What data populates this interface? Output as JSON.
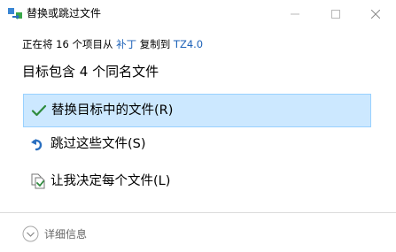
{
  "window": {
    "title": "替换或跳过文件",
    "minimize_icon": "minimize-icon",
    "maximize_icon": "maximize-icon",
    "close_icon": "close-icon"
  },
  "info": {
    "prefix": "正在将 16 个项目从",
    "source": "补丁",
    "middle": "复制到",
    "destination": "TZ4.0"
  },
  "heading": "目标包含 4 个同名文件",
  "options": [
    {
      "label": "替换目标中的文件(R)",
      "icon": "checkmark-icon",
      "selected": true
    },
    {
      "label": "跳过这些文件(S)",
      "icon": "skip-arrow-icon",
      "selected": false
    },
    {
      "label": "让我决定每个文件(L)",
      "icon": "compare-files-icon",
      "selected": false
    }
  ],
  "details": {
    "label": "详细信息",
    "icon": "chevron-down-circle-icon"
  },
  "colors": {
    "selected_bg": "#cce8ff",
    "selected_border": "#99d1ff",
    "link": "#1d62b8",
    "check": "#2e8b3d"
  }
}
